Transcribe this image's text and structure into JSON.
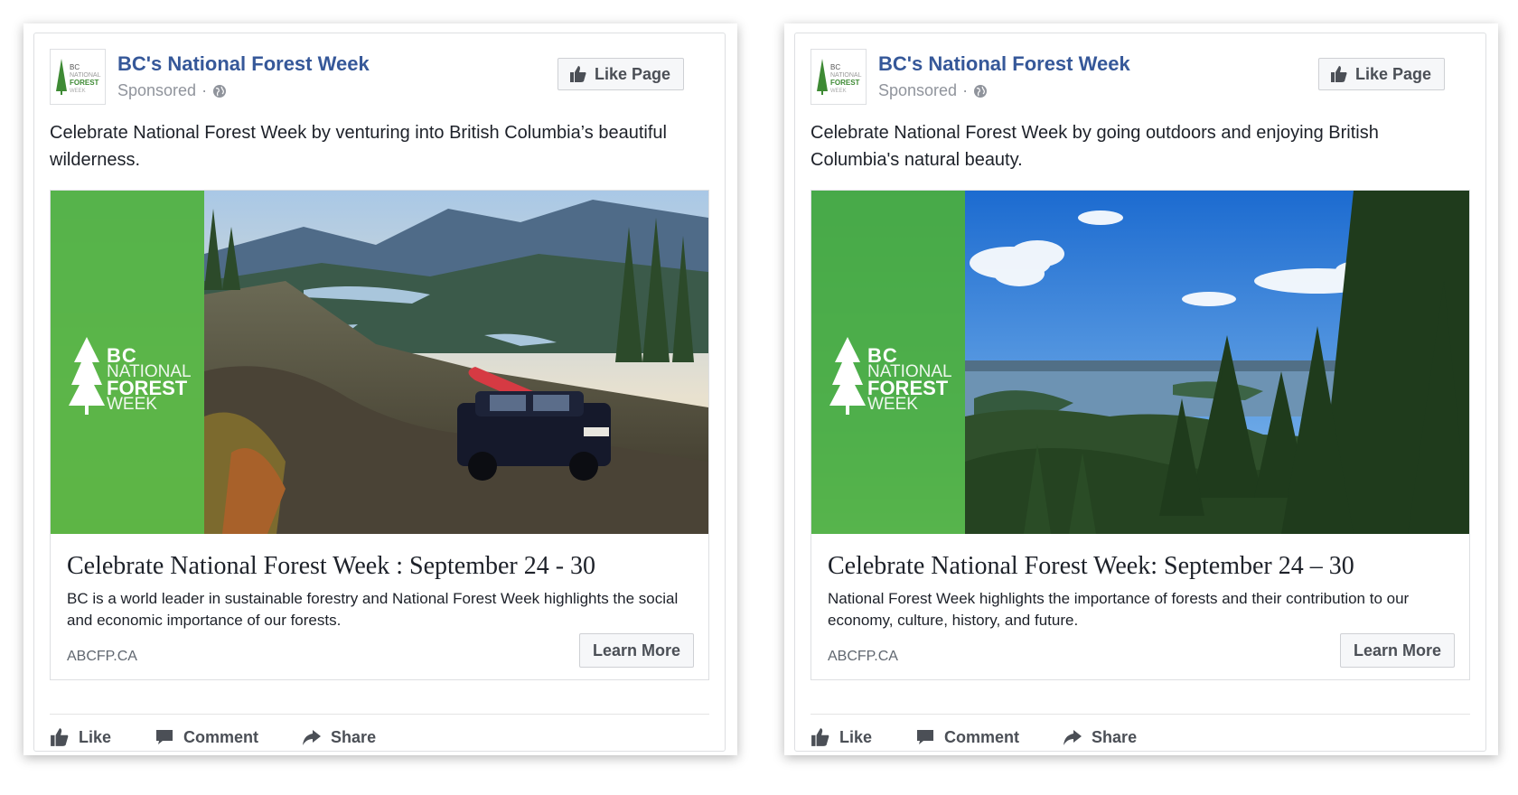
{
  "ads": [
    {
      "page_name": "BC's National Forest Week",
      "sponsored": "Sponsored",
      "like_page": "Like Page",
      "post_text": "Celebrate National Forest Week by venturing into British Columbia’s beautiful wilderness.",
      "headline": "Celebrate National Forest Week : September 24 - 30",
      "description": "BC is a world leader in sustainable forestry and National Forest Week highlights the social and economic importance of our forests.",
      "domain": "ABCFP.CA",
      "cta": "Learn More",
      "actions": {
        "like": "Like",
        "comment": "Comment",
        "share": "Share"
      }
    },
    {
      "page_name": "BC's National Forest Week",
      "sponsored": "Sponsored",
      "like_page": "Like Page",
      "post_text": "Celebrate National Forest Week by going outdoors and enjoying British Columbia's natural beauty.",
      "headline": "Celebrate National Forest Week: September 24 – 30",
      "description": "National Forest Week highlights the importance of forests and their contribution to our economy, culture, history, and future.",
      "domain": "ABCFP.CA",
      "cta": "Learn More",
      "actions": {
        "like": "Like",
        "comment": "Comment",
        "share": "Share"
      }
    }
  ],
  "logo": {
    "line1": "BC",
    "line2": "NATIONAL",
    "line3": "FOREST",
    "line4": "WEEK"
  },
  "colors": {
    "link_blue": "#365899",
    "brand_green": "#4cb03a",
    "meta_gray": "#90949c"
  }
}
